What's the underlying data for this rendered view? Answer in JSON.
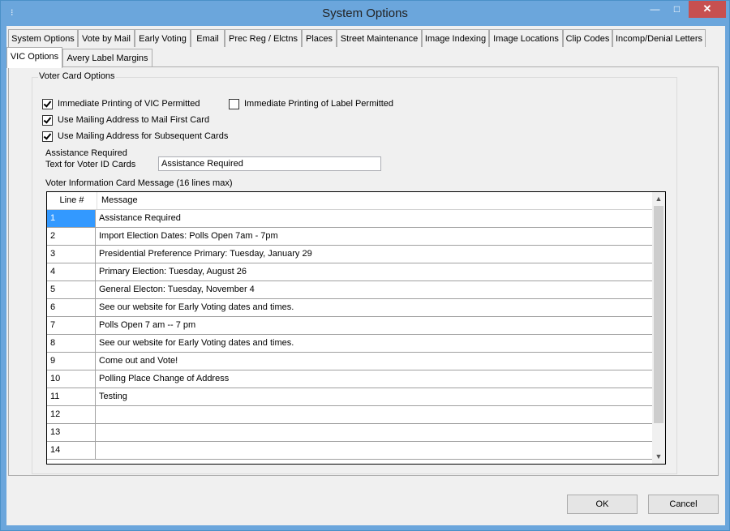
{
  "window": {
    "title": "System Options",
    "app_icon": "app-icon",
    "minimize_glyph": "—",
    "maximize_glyph": "□",
    "close_glyph": "✕"
  },
  "tabs": {
    "row1": [
      "System Options",
      "Vote by Mail",
      "Early Voting",
      "Email",
      "Prec Reg / Elctns",
      "Places",
      "Street Maintenance",
      "Image Indexing",
      "Image Locations",
      "Clip Codes",
      "Incomp/Denial Letters"
    ],
    "row2": [
      "VIC Options",
      "Avery Label Margins"
    ],
    "active": "VIC Options"
  },
  "voter_card": {
    "group_label": "Voter Card Options",
    "immediate_vic": {
      "label": "Immediate Printing of VIC Permitted",
      "checked": true
    },
    "immediate_label": {
      "label": "Immediate Printing of Label Permitted",
      "checked": false
    },
    "mailing_first": {
      "label": "Use Mailing Address to Mail First Card",
      "checked": true
    },
    "mailing_subsequent": {
      "label": "Use Mailing Address for Subsequent Cards",
      "checked": true
    },
    "assistance_label_1": "Assistance Required",
    "assistance_label_2": "Text for Voter ID Cards",
    "assistance_value": "Assistance Required",
    "message_label": "Voter Information Card Message (16 lines max)"
  },
  "grid": {
    "col_line": "Line #",
    "col_message": "Message",
    "rows": [
      {
        "line": "1",
        "message": "Assistance Required"
      },
      {
        "line": "2",
        "message": "Import Election Dates: Polls Open 7am - 7pm"
      },
      {
        "line": "3",
        "message": "Presidential Preference Primary:  Tuesday, January 29"
      },
      {
        "line": "4",
        "message": "Primary Election:   Tuesday, August 26"
      },
      {
        "line": "5",
        "message": "General Electon:  Tuesday, November 4"
      },
      {
        "line": "6",
        "message": "See our website for Early Voting dates and times."
      },
      {
        "line": "7",
        "message": "Polls Open 7 am -- 7 pm"
      },
      {
        "line": "8",
        "message": "See our website for Early Voting dates and times."
      },
      {
        "line": "9",
        "message": "Come out and Vote!"
      },
      {
        "line": "10",
        "message": "Polling Place Change of Address"
      },
      {
        "line": "11",
        "message": "Testing"
      },
      {
        "line": "12",
        "message": ""
      },
      {
        "line": "13",
        "message": ""
      },
      {
        "line": "14",
        "message": ""
      }
    ],
    "scroll_up_glyph": "▲",
    "scroll_down_glyph": "▼"
  },
  "buttons": {
    "ok": "OK",
    "cancel": "Cancel"
  }
}
